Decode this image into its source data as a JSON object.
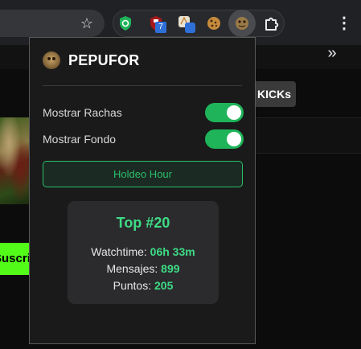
{
  "browser": {
    "star_icon": "star-icon",
    "menu_icon": "more-vert-icon",
    "overflow_chevron": "»",
    "extensions": [
      {
        "name": "shield-extension",
        "color": "#1fb45a"
      },
      {
        "name": "ublock-extension",
        "color": "#b81a1a",
        "badge": "7"
      },
      {
        "name": "translate-extension",
        "color": "#3a7bd5"
      },
      {
        "name": "cookie-extension",
        "color": "#c58b3c"
      },
      {
        "name": "pepufor-extension",
        "color": "#8a6a3c"
      },
      {
        "name": "puzzle-extension",
        "color": "#e8eaed"
      }
    ]
  },
  "page": {
    "kicks_label": "KICKs",
    "subscribe_label": "Suscribirse"
  },
  "popup": {
    "title": "PEPUFOR",
    "toggles": [
      {
        "label": "Mostrar Rachas",
        "on": true
      },
      {
        "label": "Mostrar Fondo",
        "on": true
      }
    ],
    "holdeo_label": "Holdeo Hour",
    "stats": {
      "rank": "Top #20",
      "watchtime_label": "Watchtime:",
      "watchtime_value": "06h 33m",
      "messages_label": "Mensajes:",
      "messages_value": "899",
      "points_label": "Puntos:",
      "points_value": "205"
    },
    "accent": "#3ddc84"
  }
}
